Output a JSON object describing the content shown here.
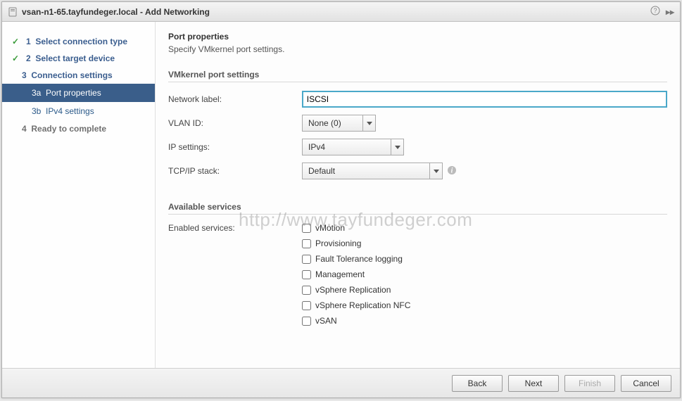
{
  "titlebar": {
    "title": "vsan-n1-65.tayfundeger.local - Add Networking"
  },
  "sidebar": {
    "steps": [
      {
        "num": "1",
        "label": "Select connection type",
        "done": true
      },
      {
        "num": "2",
        "label": "Select target device",
        "done": true
      },
      {
        "num": "3",
        "label": "Connection settings",
        "done": false
      },
      {
        "num": "4",
        "label": "Ready to complete",
        "done": false,
        "grey": true
      }
    ],
    "substeps": [
      {
        "id": "3a",
        "label": "Port properties",
        "active": true
      },
      {
        "id": "3b",
        "label": "IPv4 settings",
        "active": false
      }
    ]
  },
  "content": {
    "heading": "Port properties",
    "subheading": "Specify VMkernel port settings.",
    "section1_title": "VMkernel port settings",
    "fields": {
      "network_label": {
        "label": "Network label:",
        "value": "ISCSI"
      },
      "vlan_id": {
        "label": "VLAN ID:",
        "value": "None (0)"
      },
      "ip_settings": {
        "label": "IP settings:",
        "value": "IPv4"
      },
      "tcpip_stack": {
        "label": "TCP/IP stack:",
        "value": "Default"
      }
    },
    "section2_title": "Available services",
    "enabled_services_label": "Enabled services:",
    "services": [
      {
        "label": "vMotion",
        "checked": false
      },
      {
        "label": "Provisioning",
        "checked": false
      },
      {
        "label": "Fault Tolerance logging",
        "checked": false
      },
      {
        "label": "Management",
        "checked": false
      },
      {
        "label": "vSphere Replication",
        "checked": false
      },
      {
        "label": "vSphere Replication NFC",
        "checked": false
      },
      {
        "label": "vSAN",
        "checked": false
      }
    ]
  },
  "footer": {
    "back": "Back",
    "next": "Next",
    "finish": "Finish",
    "cancel": "Cancel"
  },
  "watermark": "http://www.tayfundeger.com"
}
